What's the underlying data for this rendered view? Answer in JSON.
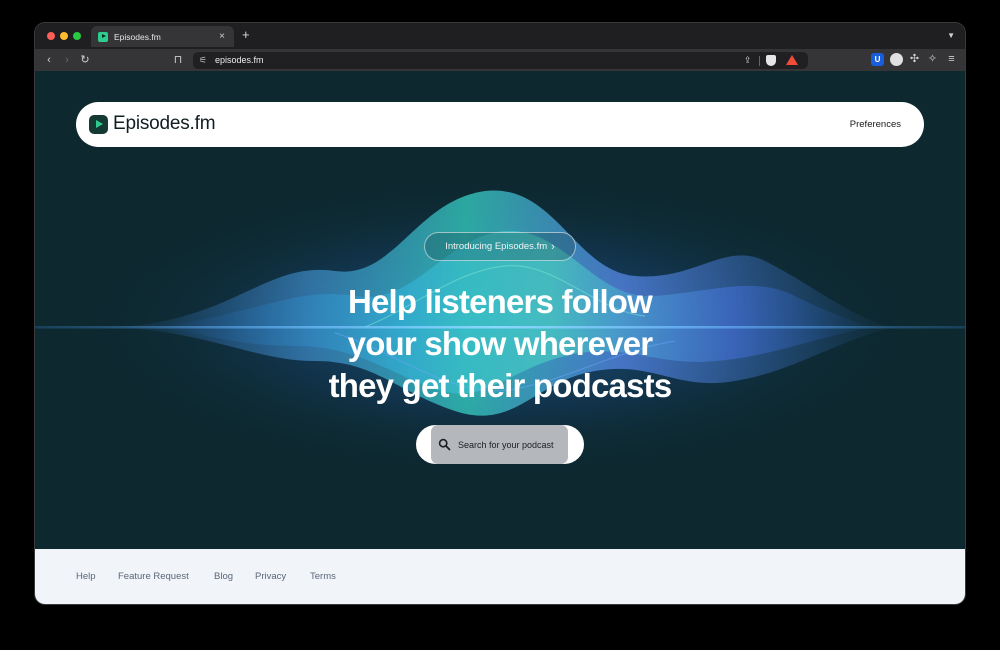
{
  "browser": {
    "tab": {
      "title": "Episodes.fm"
    },
    "new_tab_label": "+",
    "url": "episodes.fm"
  },
  "icons": {
    "back": "chevron-left-icon",
    "forward": "chevron-right-icon",
    "reload": "reload-icon",
    "bookmark": "bookmark-icon",
    "share": "share-icon",
    "brave_shield": "shield-icon",
    "rewards": "triangle-icon",
    "search": "search-icon"
  },
  "header": {
    "logo_text": "Episodes.fm",
    "preferences_label": "Preferences"
  },
  "hero": {
    "intro_label": "Introducing Episodes.fm",
    "headline_lines": [
      "Help listeners follow",
      "your show wherever",
      "they get their podcasts"
    ],
    "search_label": "Search for your podcast"
  },
  "footer": {
    "links": [
      "Help",
      "Feature Request",
      "Blog",
      "Privacy",
      "Terms"
    ]
  },
  "colors": {
    "hero_bg": "#0d282f",
    "accent": "#2ecc8f",
    "footer_bg": "#f1f4f9",
    "footer_text": "#5a6678"
  }
}
